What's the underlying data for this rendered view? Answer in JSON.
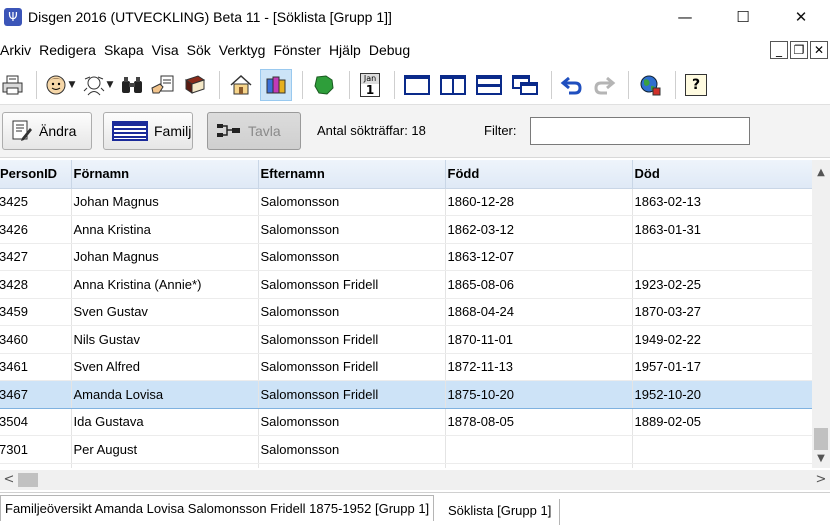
{
  "window": {
    "title": "Disgen 2016 (UTVECKLING) Beta 11 - [Söklista [Grupp 1]]",
    "app_icon_glyph": "Ψ",
    "minimize_glyph": "—",
    "maximize_glyph": "☐",
    "close_glyph": "✕"
  },
  "menu": {
    "items": [
      "Arkiv",
      "Redigera",
      "Skapa",
      "Visa",
      "Sök",
      "Verktyg",
      "Fönster",
      "Hjälp",
      "Debug"
    ],
    "mdi_minimize": "_",
    "mdi_restore": "❐",
    "mdi_close": "✕"
  },
  "toolbar": {
    "icons": [
      "printer-icon",
      "person-face-icon",
      "person-outline-icon",
      "binoculars-icon",
      "hand-document-icon",
      "book-icon",
      "home-icon",
      "books-icon",
      "map-icon",
      "calendar-icon",
      "single-pane-icon",
      "two-pane-icon",
      "split-horizontal-icon",
      "cascade-windows-icon",
      "undo-icon",
      "redo-icon",
      "globe-icon",
      "help-icon"
    ],
    "calendar_month": "Jan",
    "calendar_day": "1",
    "help_glyph": "?"
  },
  "actions": {
    "edit_label": "Ändra",
    "family_label": "Familj",
    "board_label": "Tavla",
    "hits_label": "Antal sökträffar: 18",
    "filter_label": "Filter:",
    "filter_value": ""
  },
  "grid": {
    "columns": [
      "PersonID",
      "Förnamn",
      "Efternamn",
      "Född",
      "Död"
    ],
    "rows": [
      {
        "id": "3425",
        "first": "Johan Magnus",
        "last": "Salomonsson",
        "born": "1860-12-28",
        "died": "1863-02-13"
      },
      {
        "id": "3426",
        "first": "Anna Kristina",
        "last": "Salomonsson",
        "born": "1862-03-12",
        "died": "1863-01-31"
      },
      {
        "id": "3427",
        "first": "Johan Magnus",
        "last": "Salomonsson",
        "born": "1863-12-07",
        "died": ""
      },
      {
        "id": "3428",
        "first": "Anna Kristina (Annie*)",
        "last": "Salomonsson Fridell",
        "born": "1865-08-06",
        "died": "1923-02-25"
      },
      {
        "id": "3459",
        "first": "Sven Gustav",
        "last": "Salomonsson",
        "born": "1868-04-24",
        "died": "1870-03-27"
      },
      {
        "id": "3460",
        "first": "Nils Gustav",
        "last": "Salomonsson Fridell",
        "born": "1870-11-01",
        "died": "1949-02-22"
      },
      {
        "id": "3461",
        "first": "Sven Alfred",
        "last": "Salomonsson Fridell",
        "born": "1872-11-13",
        "died": "1957-01-17"
      },
      {
        "id": "3467",
        "first": "Amanda Lovisa",
        "last": "Salomonsson Fridell",
        "born": "1875-10-20",
        "died": "1952-10-20"
      },
      {
        "id": "3504",
        "first": "Ida Gustava",
        "last": "Salomonsson",
        "born": "1878-08-05",
        "died": "1889-02-05"
      },
      {
        "id": "7301",
        "first": "Per August",
        "last": "Salomonsson",
        "born": "",
        "died": ""
      },
      {
        "id": "",
        "first": "",
        "last": "",
        "born": "",
        "died": ""
      }
    ],
    "selected_index": 7
  },
  "scroll": {
    "up": "▲",
    "down": "▼",
    "left": "<",
    "right": ">"
  },
  "tabs": {
    "family_overview": "Familjeöversikt Amanda Lovisa Salomonsson Fridell 1875-1952 [Grupp 1]",
    "search_list": "Söklista [Grupp 1]"
  },
  "colors": {
    "selected_row": "#cde3f7",
    "header_bg": "#dfe9f6",
    "accent_blue": "#1f4fbf"
  }
}
